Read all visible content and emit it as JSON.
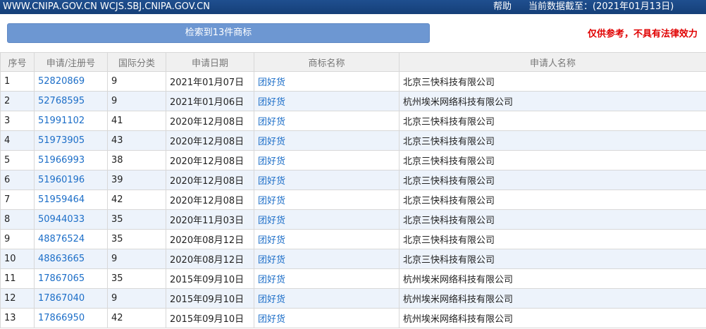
{
  "header": {
    "sites": "WWW.CNIPA.GOV.CN WCJS.SBJ.CNIPA.GOV.CN",
    "help": "帮助",
    "data_date": "当前数据截至：(2021年01月13日)"
  },
  "toolbar": {
    "result_count": "检索到13件商标",
    "disclaimer": "仅供参考，不具有法律效力"
  },
  "table": {
    "columns": [
      "序号",
      "申请/注册号",
      "国际分类",
      "申请日期",
      "商标名称",
      "申请人名称"
    ],
    "rows": [
      {
        "no": "1",
        "reg_no": "52820869",
        "class": "9",
        "date": "2021年01月07日",
        "mark": "团好货",
        "applicant": "北京三快科技有限公司"
      },
      {
        "no": "2",
        "reg_no": "52768595",
        "class": "9",
        "date": "2021年01月06日",
        "mark": "团好货",
        "applicant": "杭州埃米网络科技有限公司"
      },
      {
        "no": "3",
        "reg_no": "51991102",
        "class": "41",
        "date": "2020年12月08日",
        "mark": "团好货",
        "applicant": "北京三快科技有限公司"
      },
      {
        "no": "4",
        "reg_no": "51973905",
        "class": "43",
        "date": "2020年12月08日",
        "mark": "团好货",
        "applicant": "北京三快科技有限公司"
      },
      {
        "no": "5",
        "reg_no": "51966993",
        "class": "38",
        "date": "2020年12月08日",
        "mark": "团好货",
        "applicant": "北京三快科技有限公司"
      },
      {
        "no": "6",
        "reg_no": "51960196",
        "class": "39",
        "date": "2020年12月08日",
        "mark": "团好货",
        "applicant": "北京三快科技有限公司"
      },
      {
        "no": "7",
        "reg_no": "51959464",
        "class": "42",
        "date": "2020年12月08日",
        "mark": "团好货",
        "applicant": "北京三快科技有限公司"
      },
      {
        "no": "8",
        "reg_no": "50944033",
        "class": "35",
        "date": "2020年11月03日",
        "mark": "团好货",
        "applicant": "北京三快科技有限公司"
      },
      {
        "no": "9",
        "reg_no": "48876524",
        "class": "35",
        "date": "2020年08月12日",
        "mark": "团好货",
        "applicant": "北京三快科技有限公司"
      },
      {
        "no": "10",
        "reg_no": "48863665",
        "class": "9",
        "date": "2020年08月12日",
        "mark": "团好货",
        "applicant": "北京三快科技有限公司"
      },
      {
        "no": "11",
        "reg_no": "17867065",
        "class": "35",
        "date": "2015年09月10日",
        "mark": "团好货",
        "applicant": "杭州埃米网络科技有限公司"
      },
      {
        "no": "12",
        "reg_no": "17867040",
        "class": "9",
        "date": "2015年09月10日",
        "mark": "团好货",
        "applicant": "杭州埃米网络科技有限公司"
      },
      {
        "no": "13",
        "reg_no": "17866950",
        "class": "42",
        "date": "2015年09月10日",
        "mark": "团好货",
        "applicant": "杭州埃米网络科技有限公司"
      }
    ]
  },
  "colors": {
    "header_bg": "#1f4f8f",
    "button_bg": "#6d97d2",
    "link": "#1c6ec8",
    "disclaimer": "#e00000",
    "row_alt": "#edf3fb"
  }
}
